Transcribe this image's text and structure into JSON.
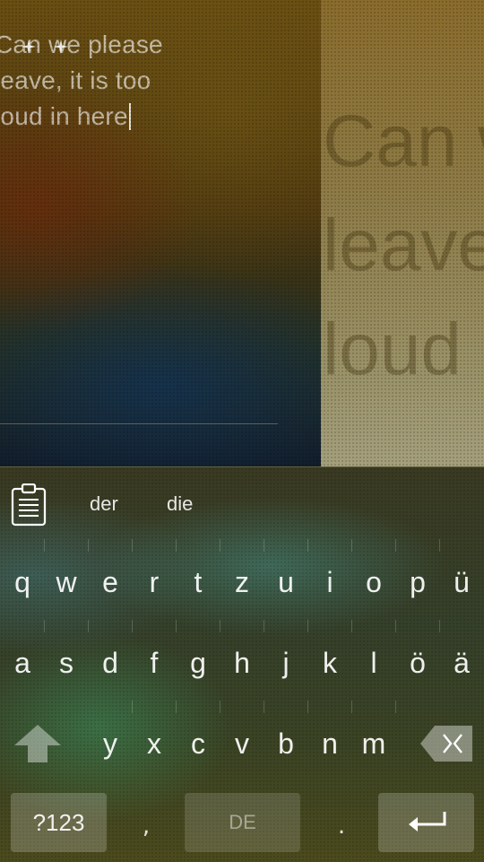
{
  "note": {
    "lines": [
      "Can we please",
      "leave, it is too",
      "loud in here"
    ]
  },
  "preview": {
    "lines": [
      "Can w",
      "leave",
      "loud"
    ]
  },
  "keyboard": {
    "suggestions": [
      "der",
      "die"
    ],
    "row1": [
      "q",
      "w",
      "e",
      "r",
      "t",
      "z",
      "u",
      "i",
      "o",
      "p",
      "ü"
    ],
    "row2": [
      "a",
      "s",
      "d",
      "f",
      "g",
      "h",
      "j",
      "k",
      "l",
      "ö",
      "ä"
    ],
    "row3": [
      "y",
      "x",
      "c",
      "v",
      "b",
      "n",
      "m"
    ],
    "symbols_label": "?123",
    "comma_label": ",",
    "language_label": "DE",
    "period_label": ".",
    "icons": {
      "clipboard": "clipboard-icon",
      "shift": "shift-arrow-icon",
      "backspace": "backspace-icon",
      "enter": "enter-arrow-icon"
    }
  }
}
